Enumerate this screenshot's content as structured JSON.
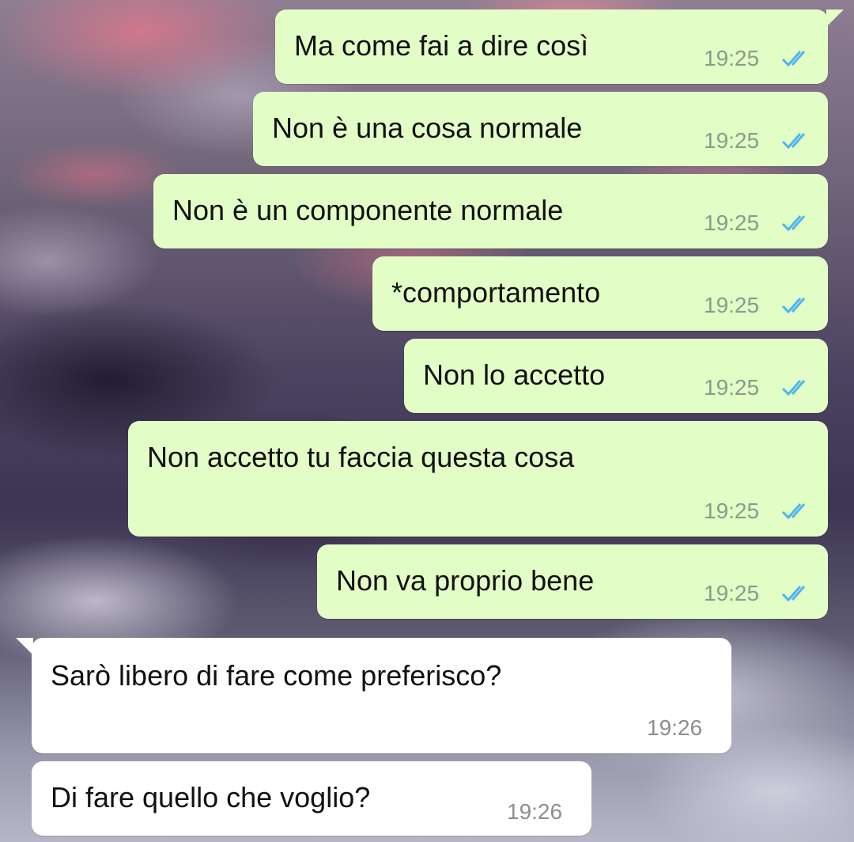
{
  "colors": {
    "outgoing_bubble": "#e3fdc7",
    "incoming_bubble": "#ffffff",
    "read_ticks": "#4fb6ec",
    "timestamp": "#8e9a8a"
  },
  "messages": [
    {
      "direction": "outgoing",
      "text": "Ma come fai a dire così",
      "time": "19:25",
      "status_icon": "double-check-read-icon"
    },
    {
      "direction": "outgoing",
      "text": "Non è una cosa normale",
      "time": "19:25",
      "status_icon": "double-check-read-icon"
    },
    {
      "direction": "outgoing",
      "text": "Non è un componente normale",
      "time": "19:25",
      "status_icon": "double-check-read-icon"
    },
    {
      "direction": "outgoing",
      "text": "*comportamento",
      "time": "19:25",
      "status_icon": "double-check-read-icon"
    },
    {
      "direction": "outgoing",
      "text": "Non lo accetto",
      "time": "19:25",
      "status_icon": "double-check-read-icon"
    },
    {
      "direction": "outgoing",
      "text": "Non accetto tu faccia questa cosa",
      "time": "19:25",
      "status_icon": "double-check-read-icon"
    },
    {
      "direction": "outgoing",
      "text": "Non va proprio bene",
      "time": "19:25",
      "status_icon": "double-check-read-icon"
    },
    {
      "direction": "incoming",
      "text": "Sarò libero di fare come preferisco?",
      "time": "19:26"
    },
    {
      "direction": "incoming",
      "text": "Di fare quello che voglio?",
      "time": "19:26"
    }
  ]
}
